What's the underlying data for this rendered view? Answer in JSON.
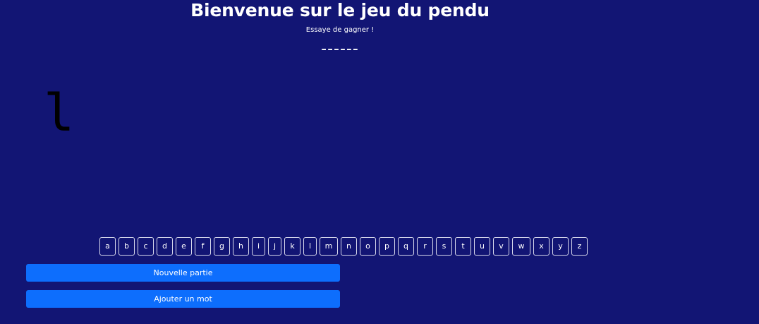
{
  "header": {
    "title": "Bienvenue sur le jeu du pendu",
    "subtitle": "Essaye de gagner !"
  },
  "game": {
    "masked_word": "------",
    "hangman_art": "l"
  },
  "keyboard": {
    "letters": [
      "a",
      "b",
      "c",
      "d",
      "e",
      "f",
      "g",
      "h",
      "i",
      "j",
      "k",
      "l",
      "m",
      "n",
      "o",
      "p",
      "q",
      "r",
      "s",
      "t",
      "u",
      "v",
      "w",
      "x",
      "y",
      "z"
    ]
  },
  "actions": {
    "new_game_label": "Nouvelle partie",
    "add_word_label": "Ajouter un mot"
  },
  "colors": {
    "background": "#121574",
    "button_primary": "#0d6efd",
    "key_border": "#d8d9ec",
    "text": "#ffffff"
  }
}
